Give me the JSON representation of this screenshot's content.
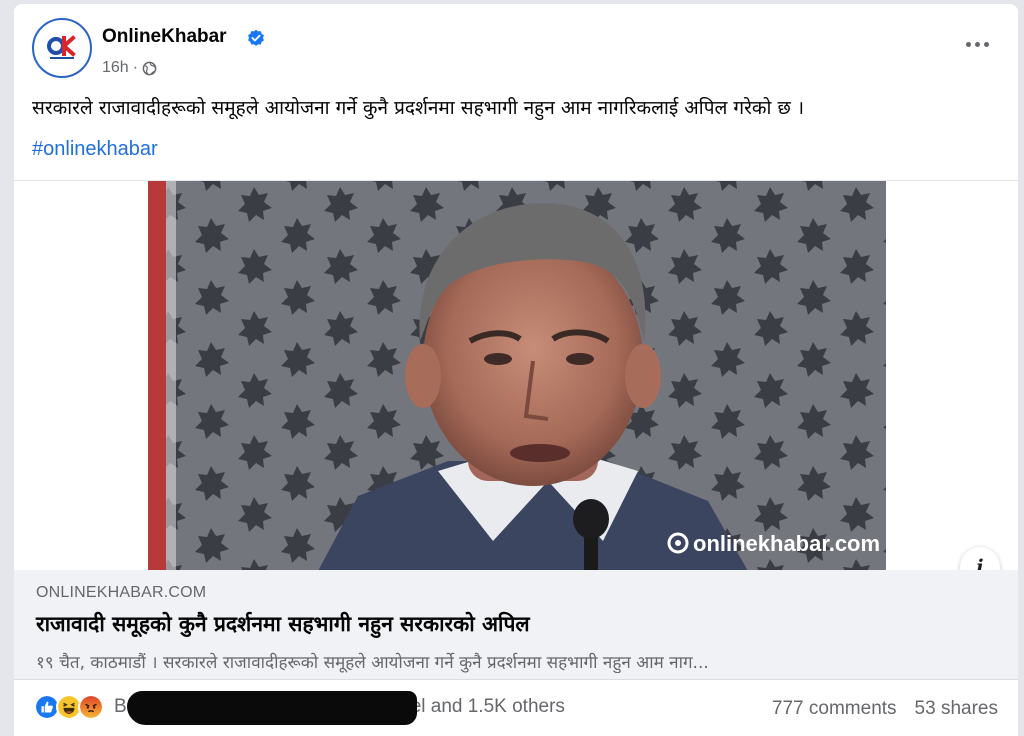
{
  "post": {
    "page_name": "OnlineKhabar",
    "time": "16h",
    "dot": "·",
    "text": "सरकारले राजावादीहरूको समूहले आयोजना गर्ने कुनै प्रदर्शनमा सहभागी नहुन आम नागरिकलाई अपिल गरेको छ ।",
    "hashtag": "#onlinekhabar"
  },
  "image": {
    "watermark": "onlinekhabar.com"
  },
  "link": {
    "domain": "ONLINEKHABAR.COM",
    "title": "राजावादी समूहको कुनै प्रदर्शनमा सहभागी नहुन सरकारको अपिल",
    "description": "१९ चैत, काठमाडौं । सरकारले राजावादीहरूको समूहले आयोजना गर्ने कुनै प्रदर्शनमा सहभागी नहुन आम नाग..."
  },
  "engagement": {
    "names_prefix": "B",
    "names_suffix": "el and 1.5K others",
    "comments": "777 comments",
    "shares": "53 shares"
  },
  "colors": {
    "brand_blue": "#1877f2",
    "link_blue": "#216fdb",
    "like_blue": "#1877f2",
    "angry_orange": "#f15c32",
    "haha_yellow": "#f7c52b"
  },
  "icons": [
    "verified-badge-icon",
    "globe-icon",
    "more-options-icon",
    "info-icon",
    "like-reaction-icon",
    "haha-reaction-icon",
    "angry-reaction-icon"
  ]
}
